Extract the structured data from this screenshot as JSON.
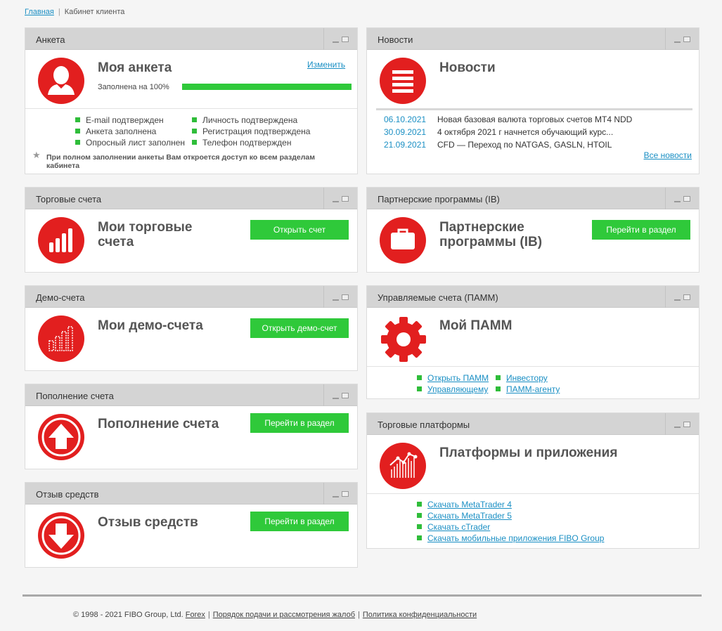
{
  "breadcrumb": {
    "home": "Главная",
    "current": "Кабинет клиента"
  },
  "profile": {
    "header": "Анкета",
    "title": "Моя анкета",
    "edit_link": "Изменить",
    "progress_label": "Заполнена на 100%",
    "progress_value": 1.0,
    "checks_left": [
      "E-mail подтвержден",
      "Анкета заполнена",
      "Опросный лист заполнен"
    ],
    "checks_right": [
      "Личность подтверждена",
      "Регистрация подтверждена",
      "Телефон подтвержден"
    ],
    "note": "При полном заполнении анкеты Вам откроется доступ ко всем разделам кабинета"
  },
  "news": {
    "header": "Новости",
    "title": "Новости",
    "items": [
      {
        "date": "06.10.2021",
        "text": "Новая базовая валюта торговых счетов MT4 NDD"
      },
      {
        "date": "30.09.2021",
        "text": "4 октября 2021 г начнется обучающий курс..."
      },
      {
        "date": "21.09.2021",
        "text": "CFD — Переход по NATGAS, GASLN, HTOIL"
      }
    ],
    "all_link": "Все новости"
  },
  "trading": {
    "header": "Торговые счета",
    "title_line1": "Мои торговые",
    "title_line2": "счета",
    "button": "Открыть счет"
  },
  "partner": {
    "header": "Партнерские программы (IB)",
    "title_line1": "Партнерские",
    "title_line2": "программы (IB)",
    "button": "Перейти в раздел"
  },
  "demo": {
    "header": "Демо-счета",
    "title": "Мои демо-счета",
    "button": "Открыть демо-счет"
  },
  "pamm": {
    "header": "Управляемые счета (ПАММ)",
    "title": "Мой ПАММ",
    "links_left": [
      "Открыть ПАММ",
      "Управляющему"
    ],
    "links_right": [
      "Инвестору",
      "ПАММ-агенту"
    ]
  },
  "deposit": {
    "header": "Пополнение счета",
    "title": "Пополнение счета",
    "button": "Перейти в раздел"
  },
  "platforms": {
    "header": "Торговые платформы",
    "title": "Платформы и приложения",
    "links": [
      "Скачать MetaTrader 4",
      "Скачать MetaTrader 5",
      "Скачать cTrader",
      "Скачать мобильные приложения FIBO Group"
    ]
  },
  "withdraw": {
    "header": "Отзыв средств",
    "title": "Отзыв средств",
    "button": "Перейти в раздел"
  },
  "footer": {
    "copyright": "© 1998 - 2021 FIBO Group, Ltd.",
    "forex": "Forex",
    "complaints": "Порядок подачи и рассмотрения жалоб",
    "privacy": "Политика конфиденциальности"
  },
  "colors": {
    "accent_red": "#e21f1f",
    "accent_green": "#2fc93a",
    "link": "#1a8fc4"
  }
}
